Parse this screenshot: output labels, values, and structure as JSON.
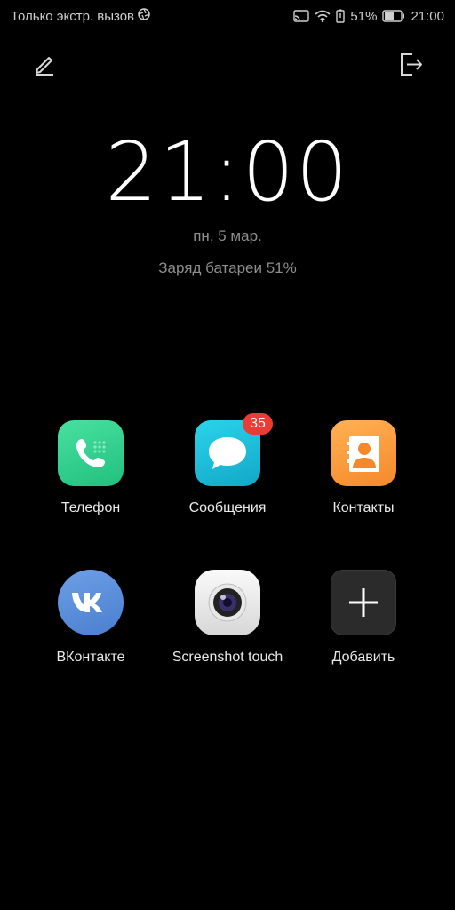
{
  "status_bar": {
    "carrier_text": "Только экстр. вызов",
    "battery_percent": "51%",
    "time": "21:00",
    "icons": [
      "aperture-icon",
      "cast-icon",
      "wifi-icon",
      "battery-saver-icon",
      "battery-icon"
    ]
  },
  "top_actions": {
    "edit_icon": "pencil-icon",
    "exit_icon": "exit-icon"
  },
  "clock": {
    "time": "21:00",
    "date": "пн, 5 мар.",
    "charge": "Заряд батареи 51%"
  },
  "apps": [
    {
      "label": "Телефон",
      "icon": "phone-icon",
      "color": "#2fcf8a"
    },
    {
      "label": "Сообщения",
      "icon": "messages-icon",
      "color": "#1fbfdc",
      "badge": "35"
    },
    {
      "label": "Контакты",
      "icon": "contacts-icon",
      "color": "#f7992f"
    },
    {
      "label": "ВКонтакте",
      "icon": "vk-icon",
      "color": "#5a8ddb"
    },
    {
      "label": "Screenshot touch",
      "icon": "camera-lens-icon",
      "color": "#ececec"
    },
    {
      "label": "Добавить",
      "icon": "plus-icon",
      "color": "#2b2b2b"
    }
  ]
}
